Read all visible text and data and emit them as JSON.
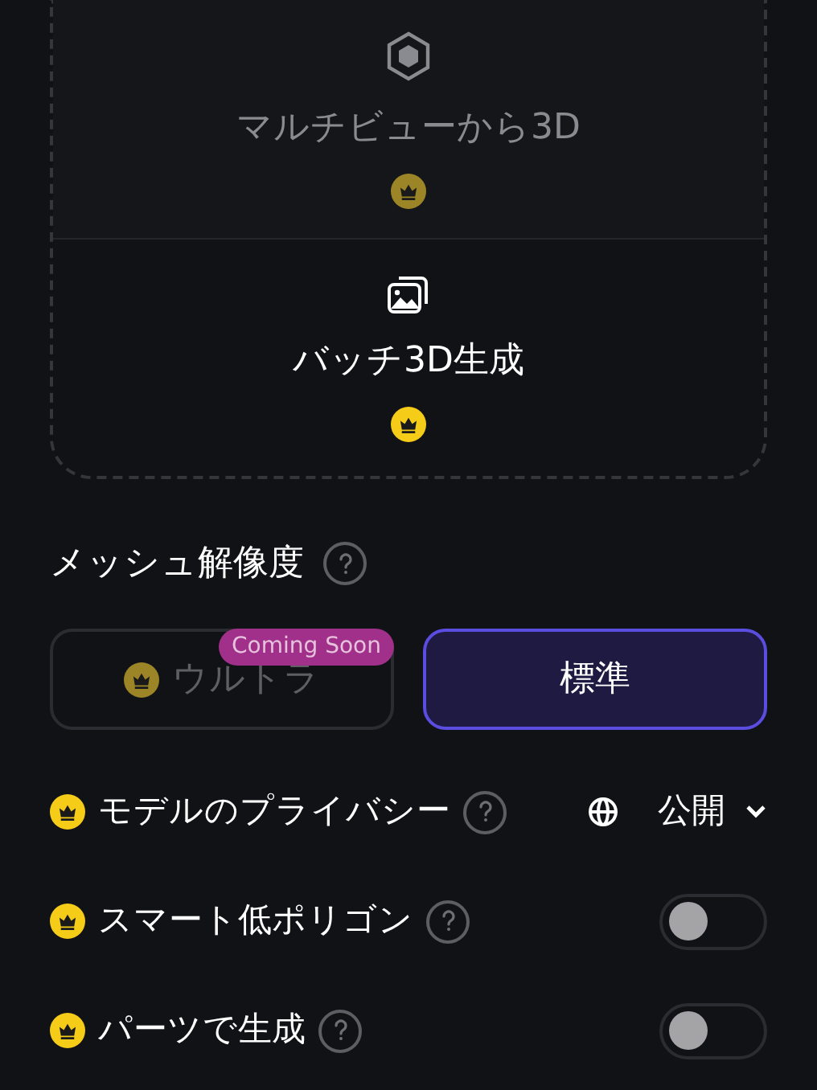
{
  "modes": [
    {
      "label": "マルチビューから3D",
      "kind": "cube",
      "disabled": true
    },
    {
      "label": "バッチ3D生成",
      "kind": "images",
      "disabled": false
    }
  ],
  "mesh_resolution": {
    "title": "メッシュ解像度",
    "options": [
      {
        "label": "ウルトラ",
        "selected": false,
        "disabled": true,
        "premium": true,
        "badge": "Coming Soon"
      },
      {
        "label": "標準",
        "selected": true,
        "disabled": false,
        "premium": false
      }
    ]
  },
  "settings": [
    {
      "kind": "dropdown",
      "label": "モデルのプライバシー",
      "value": "公開"
    },
    {
      "kind": "toggle",
      "label": "スマート低ポリゴン",
      "on": false
    },
    {
      "kind": "toggle",
      "label": "パーツで生成",
      "on": false
    }
  ]
}
